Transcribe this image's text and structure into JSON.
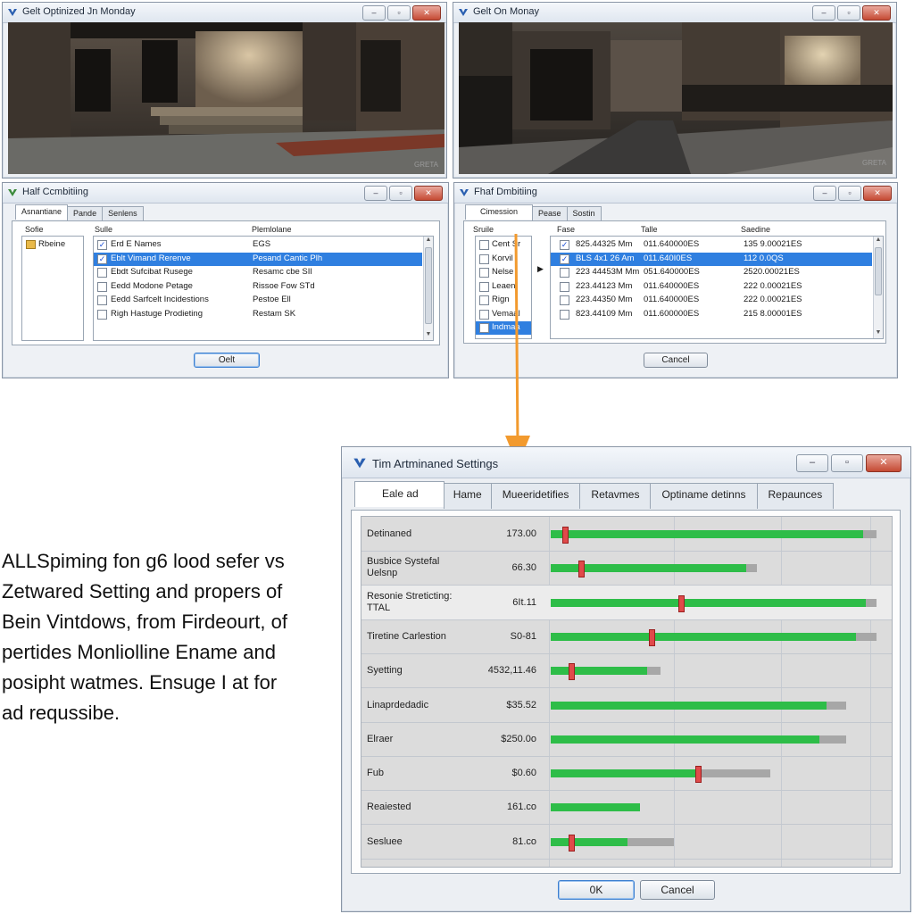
{
  "win1": {
    "title": "Gelt Optinized Jn Monday",
    "viewport_caption": "GRETA",
    "dialog": {
      "title": "Half Ccmbitiing",
      "tabs": [
        "Asnantiane",
        "Pande",
        "Senlens"
      ],
      "left_header": "Sofie",
      "left_items": [
        "Rbeine"
      ],
      "columns": [
        "Sulle",
        "Plemlolane"
      ],
      "rows": [
        {
          "checked": true,
          "name": "Erd E Names",
          "value": "EGS",
          "selected": false
        },
        {
          "checked": true,
          "name": "Eblt Vimand Rerenve",
          "value": "Pesand Cantic Plh",
          "selected": true
        },
        {
          "checked": false,
          "name": "Ebdt Sufcibat Rusege",
          "value": "Resamc cbe SIl",
          "selected": false
        },
        {
          "checked": false,
          "name": "Eedd Modone Petage",
          "value": "Rissoe Fow STd",
          "selected": false
        },
        {
          "checked": false,
          "name": "Eedd Sarfcelt Incidestions",
          "value": "Pestoe Ell",
          "selected": false
        },
        {
          "checked": false,
          "name": "Righ Hastuge Prodieting",
          "value": "Restam SK",
          "selected": false
        }
      ],
      "ok_label": "Oelt"
    }
  },
  "win2": {
    "title": "Gelt On Monay",
    "viewport_caption": "GRETA",
    "dialog": {
      "title": "Fhaf Dmbitiing",
      "tabs": [
        "Cimession",
        "Pease",
        "Sostin"
      ],
      "left_header": "Sruile",
      "left_items": [
        "Cent Sr",
        "Korvil",
        "Nelse",
        "Leaen",
        "Rign",
        "Vemaal",
        "Indmaa"
      ],
      "columns": [
        "Fase",
        "Talle",
        "Saedine"
      ],
      "rows": [
        {
          "checked": true,
          "a": "825.44325 Mm",
          "b": "011.640000ES",
          "c": "135 9.00021ES",
          "selected": false
        },
        {
          "checked": true,
          "a": "BLS 4x1 26 Am",
          "b": "011.640I0ES",
          "c": "112 0.0QS",
          "selected": true
        },
        {
          "checked": false,
          "a": "223 44453M Mm",
          "b": "051.640000ES",
          "c": "2520.00021ES",
          "selected": false
        },
        {
          "checked": false,
          "a": "223.44123 Mm",
          "b": "011.640000ES",
          "c": "222 0.00021ES",
          "selected": false
        },
        {
          "checked": false,
          "a": "223.44350 Mm",
          "b": "011.640000ES",
          "c": "222 0.00021ES",
          "selected": false
        },
        {
          "checked": false,
          "a": "823.44109 Mm",
          "b": "011.600000ES",
          "c": "215 8.00001ES",
          "selected": false
        }
      ],
      "cancel_label": "Cancel"
    }
  },
  "side_text": [
    "ALLSpiming fon g6 lood sefer vs",
    "Zetwared Setting and propers of",
    "Bein Vintdows, from Firdeourt, of",
    "pertides Monliolline Ename and",
    "posipht watmes. Ensuge I at for",
    "ad requssibe."
  ],
  "main": {
    "title": "Tim Artminaned Settings",
    "tabs": [
      "Eale ad",
      "Hame",
      "Mueeridetifies",
      "Retavmes",
      "Optiname detinns",
      "Repaunces"
    ],
    "ok_label": "0K",
    "cancel_label": "Cancel",
    "colors": {
      "fill": "#2ebd48",
      "track": "#a7a7a7",
      "marker": "#e04a4a",
      "selection": "#2f7fe0"
    },
    "rows": [
      {
        "label": "Detinaned",
        "value": "173.00",
        "fill": 0.94,
        "track": 0.98,
        "marker": 0.04
      },
      {
        "label": "Busbice Systefal Uelsnp",
        "value": "66.30",
        "fill": 0.59,
        "track": 0.62,
        "marker": 0.09
      },
      {
        "label": "Resonie Streticting: TTAL",
        "value": "6It.11",
        "fill": 0.95,
        "track": 0.98,
        "marker": 0.39
      },
      {
        "label": "Tiretine Carlestion",
        "value": "S0-81",
        "fill": 0.92,
        "track": 0.98,
        "marker": 0.3
      },
      {
        "label": "Syetting",
        "value": "4532,11.46",
        "fill": 0.29,
        "track": 0.33,
        "marker": 0.06
      },
      {
        "label": "Linaprdedadic",
        "value": "$35.52",
        "fill": 0.83,
        "track": 0.89,
        "marker": null
      },
      {
        "label": "Elraer",
        "value": "$250.0o",
        "fill": 0.81,
        "track": 0.89,
        "marker": null
      },
      {
        "label": "Fub",
        "value": "$0.60",
        "fill": 0.44,
        "track": 0.66,
        "marker": 0.44
      },
      {
        "label": "Reaiested",
        "value": "161.co",
        "fill": 0.27,
        "track": 0.27,
        "marker": null
      },
      {
        "label": "Sesluee",
        "value": "81.co",
        "fill": 0.23,
        "track": 0.37,
        "marker": 0.06
      }
    ]
  }
}
